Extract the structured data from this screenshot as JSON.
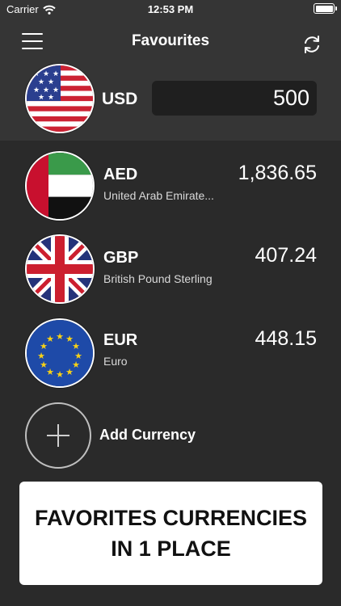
{
  "status_bar": {
    "carrier": "Carrier",
    "time": "12:53 PM"
  },
  "header": {
    "title": "Favourites",
    "menu_icon": "hamburger-icon",
    "refresh_icon": "refresh-icon"
  },
  "base": {
    "code": "USD",
    "amount": "500",
    "flag": "us-flag"
  },
  "favourites": [
    {
      "code": "AED",
      "name": "United Arab Emirate...",
      "value": "1,836.65",
      "flag": "ae-flag"
    },
    {
      "code": "GBP",
      "name": "British Pound Sterling",
      "value": "407.24",
      "flag": "gb-flag"
    },
    {
      "code": "EUR",
      "name": "Euro",
      "value": "448.15",
      "flag": "eu-flag"
    }
  ],
  "add": {
    "label": "Add Currency",
    "icon": "plus-icon"
  },
  "banner": {
    "line1": "FAVORITES CURRENCIES",
    "line2": "IN 1 PLACE"
  },
  "colors": {
    "background": "#2a2a2a",
    "header": "#353535",
    "input": "#1f1f1f",
    "banner": "#ffffff"
  }
}
